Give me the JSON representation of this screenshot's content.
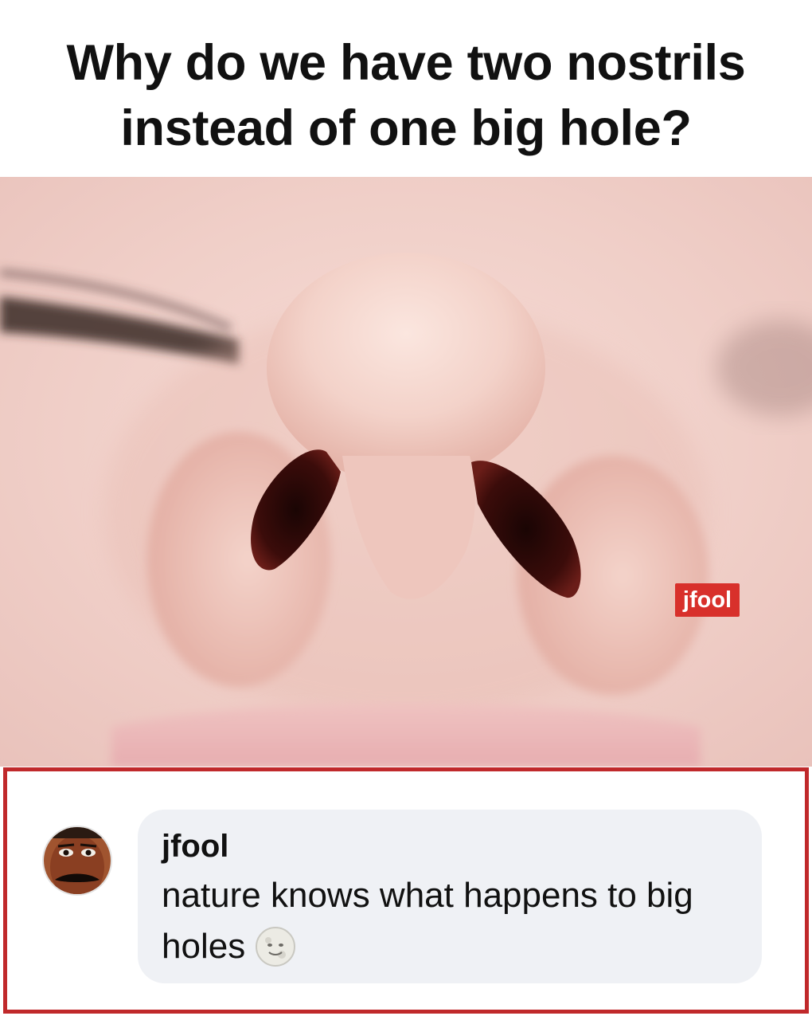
{
  "headline": {
    "text": "Why do we have two nostrils instead of one big hole?"
  },
  "photo": {
    "subject": "nose-closeup",
    "watermark": "jfool",
    "watermark_color": "#d8302b"
  },
  "comment": {
    "frame_color": "#c0292b",
    "bubble_color": "#eff1f5",
    "author": "jfool",
    "text": "nature knows what happens to big holes",
    "emoji": "full-moon-face-icon"
  }
}
